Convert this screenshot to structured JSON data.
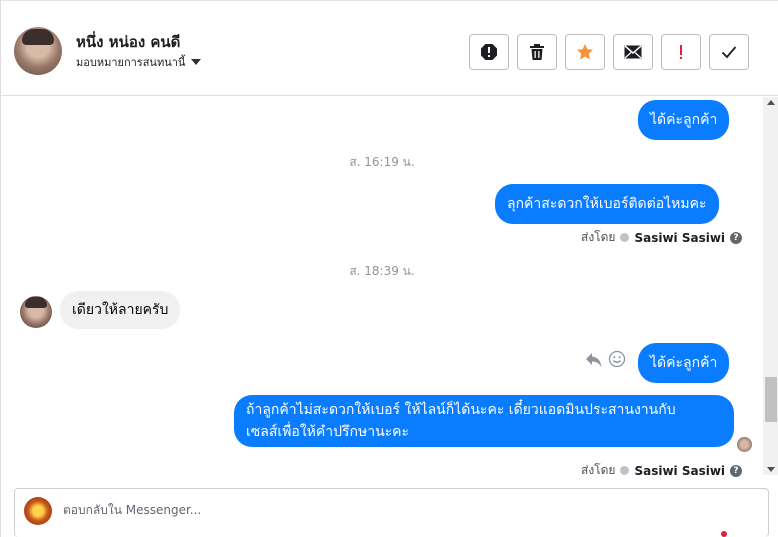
{
  "header": {
    "name": "หนึ่ง หน่อง คนดี",
    "assign_label": "มอบหมายการสนทนานี้"
  },
  "colors": {
    "accent": "#0a7cff",
    "star": "#f7923b",
    "alert": "#e41e3f"
  },
  "actions": [
    {
      "name": "spam-icon"
    },
    {
      "name": "trash-icon"
    },
    {
      "name": "star-icon"
    },
    {
      "name": "envelope-icon"
    },
    {
      "name": "exclamation-icon"
    },
    {
      "name": "check-icon"
    }
  ],
  "messages": {
    "m1": "ได้ค่ะลูกค้า",
    "ts1": "ส. 16:19 น.",
    "m2": "ลุกค้าสะดวกให้เบอร์ติดต่อไหมคะ",
    "sent_prefix": "ส่งโดย",
    "sender": "Sasiwi Sasiwi",
    "ts2": "ส. 18:39 น.",
    "m3": "เดียวให้ลายครับ",
    "m4": "ได้ค่ะลูกค้า",
    "m5_line1": "ถ้าลูกค้าไม่สะดวกให้เบอร์ ให้ไลน์ก็ได้นะคะ  เดี๋ยวแอดมินประสานงานกับ",
    "m5_line2": "เซลส์เพื่อให้คำปรึกษานะคะ"
  },
  "composer": {
    "placeholder": "ตอบกลับใน Messenger..."
  }
}
